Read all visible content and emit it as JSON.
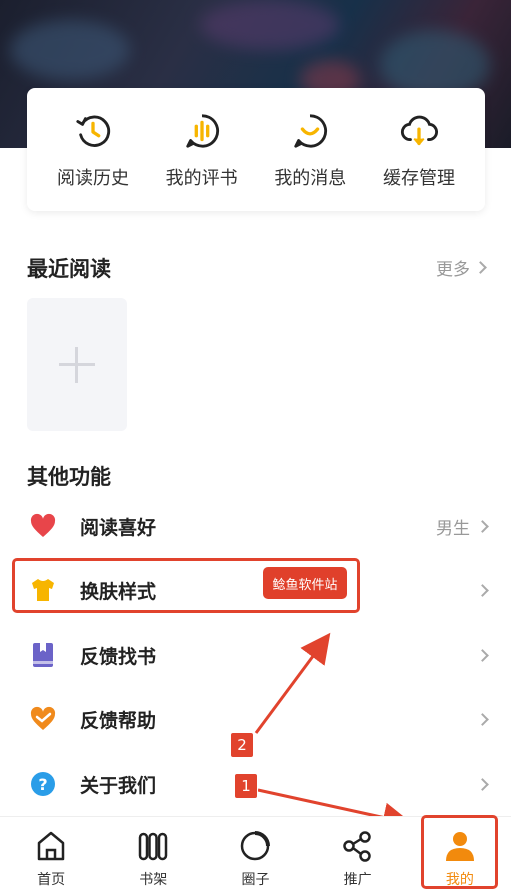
{
  "quick_actions": [
    {
      "label": "阅读历史",
      "icon": "clock-history-icon"
    },
    {
      "label": "我的评书",
      "icon": "voice-bubble-icon"
    },
    {
      "label": "我的消息",
      "icon": "message-smile-icon"
    },
    {
      "label": "缓存管理",
      "icon": "cloud-download-icon"
    }
  ],
  "recent": {
    "title": "最近阅读",
    "more": "更多"
  },
  "other": {
    "title": "其他功能",
    "items": [
      {
        "label": "阅读喜好",
        "value": "男生",
        "icon": "heart-icon"
      },
      {
        "label": "换肤样式",
        "value": "",
        "icon": "tshirt-icon"
      },
      {
        "label": "反馈找书",
        "value": "",
        "icon": "book-icon"
      },
      {
        "label": "反馈帮助",
        "value": "",
        "icon": "feedback-heart-icon"
      },
      {
        "label": "关于我们",
        "value": "",
        "icon": "question-circle-icon"
      }
    ]
  },
  "watermark": "鲶鱼软件站",
  "annotations": {
    "badge_1": "1",
    "badge_2": "2"
  },
  "tabs": [
    {
      "label": "首页",
      "icon": "home-icon"
    },
    {
      "label": "书架",
      "icon": "bookshelf-icon"
    },
    {
      "label": "圈子",
      "icon": "circle-icon"
    },
    {
      "label": "推广",
      "icon": "share-icon"
    },
    {
      "label": "我的",
      "icon": "user-icon",
      "active": true
    }
  ],
  "colors": {
    "accent": "#f28a0d",
    "annotation_red": "#e1432d",
    "icon_yellow": "#f7b500"
  }
}
